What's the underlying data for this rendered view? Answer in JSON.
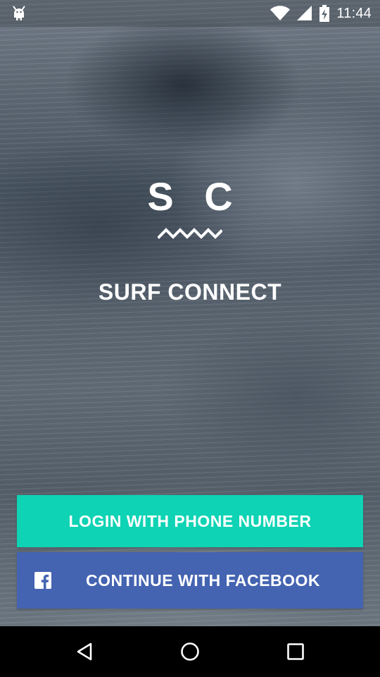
{
  "status_bar": {
    "time": "11:44",
    "icons": [
      "android-debug-icon",
      "wifi-icon",
      "cellular-signal-icon",
      "battery-charging-icon"
    ]
  },
  "logo": {
    "letters": "S C",
    "mark": "wave-mark-icon"
  },
  "app": {
    "title": "SURF CONNECT"
  },
  "buttons": {
    "phone_label": "LOGIN WITH PHONE NUMBER",
    "facebook_label": "CONTINUE WITH FACEBOOK",
    "facebook_icon": "facebook-icon"
  },
  "nav_bar": {
    "items": [
      "back-icon",
      "home-icon",
      "recents-icon"
    ]
  },
  "colors": {
    "phone_button": "#0ed3b4",
    "facebook_button": "#4463b1",
    "text": "#ffffff",
    "nav_bar": "#000000"
  }
}
